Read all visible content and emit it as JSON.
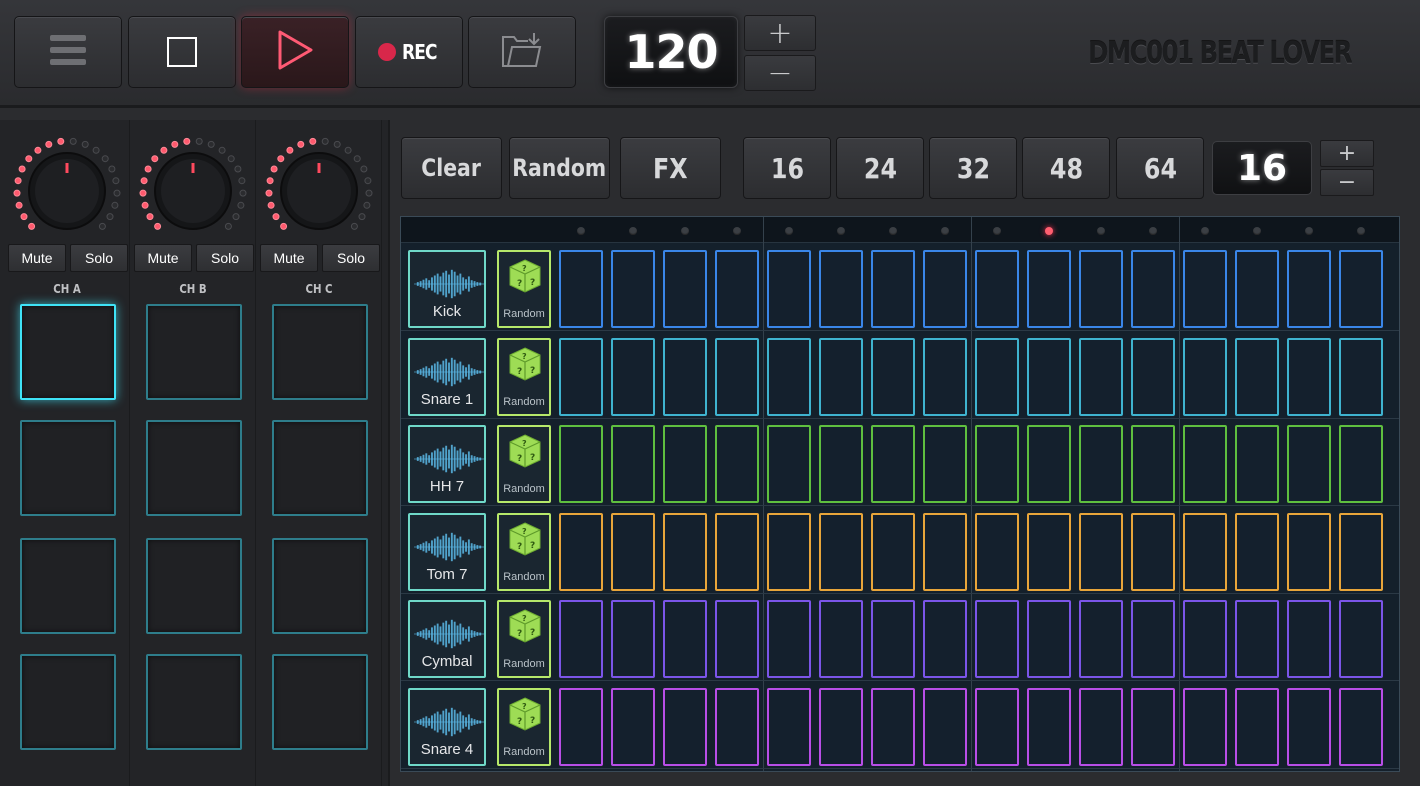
{
  "app_title": "DMC001 BEAT LOVER",
  "topbar": {
    "rec_label": "REC",
    "tempo": "120",
    "plus": "+",
    "minus": "−"
  },
  "mixer": {
    "channels": [
      {
        "label": "CH A",
        "mute": "Mute",
        "solo": "Solo"
      },
      {
        "label": "CH B",
        "mute": "Mute",
        "solo": "Solo"
      },
      {
        "label": "CH C",
        "mute": "Mute",
        "solo": "Solo"
      }
    ]
  },
  "sequencer": {
    "clear": "Clear",
    "random": "Random",
    "fx": "FX",
    "step_options": [
      "16",
      "24",
      "32",
      "48",
      "64"
    ],
    "steps_value": "16",
    "plus": "+",
    "minus": "−",
    "active_step": 10,
    "tracks": [
      {
        "name": "Kick",
        "random": "Random",
        "color": "#3a86e8"
      },
      {
        "name": "Snare 1",
        "random": "Random",
        "color": "#3fb3cf"
      },
      {
        "name": "HH 7",
        "random": "Random",
        "color": "#5fbf3f"
      },
      {
        "name": "Tom 7",
        "random": "Random",
        "color": "#e8a53a"
      },
      {
        "name": "Cymbal",
        "random": "Random",
        "color": "#7b55e8"
      },
      {
        "name": "Snare 4",
        "random": "Random",
        "color": "#b84ee6"
      }
    ]
  },
  "colors": {
    "accent_play": "#ff3a5a",
    "pad_active": "#3fe3f7",
    "sound_border": "#6fd8c8",
    "random_border": "#b6e86a"
  }
}
